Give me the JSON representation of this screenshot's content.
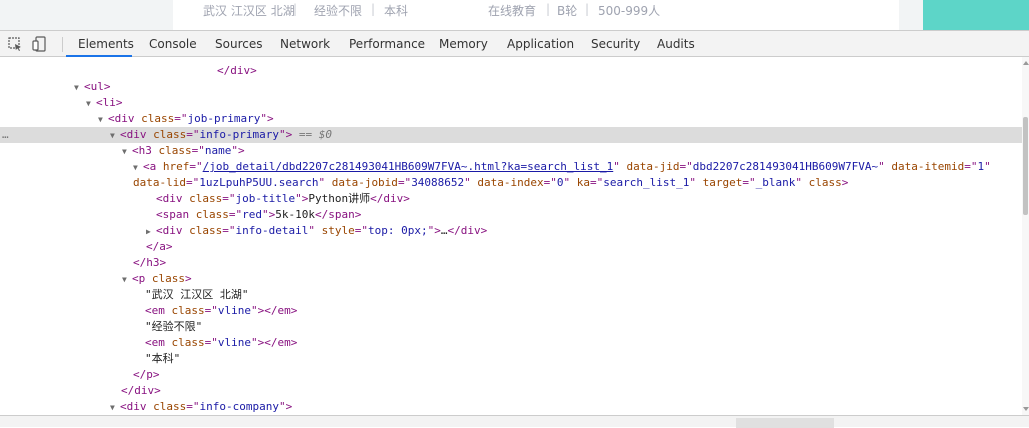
{
  "page": {
    "location": [
      "武汉",
      "江汉区",
      "北湖"
    ],
    "experience": "经验不限",
    "education": "本科",
    "industry": "在线教育",
    "stage": "B轮",
    "size": "500-999人",
    "separator": "|"
  },
  "devtools": {
    "tabs": [
      "Elements",
      "Console",
      "Sources",
      "Network",
      "Performance",
      "Memory",
      "Application",
      "Security",
      "Audits"
    ],
    "active_tab": "Elements",
    "selected_marker": "== $0",
    "dots": "…"
  },
  "tree": {
    "closing_div": "</div>",
    "ul": "<ul>",
    "li": "<li>",
    "div_open": "<div",
    "h3_open": "<h3",
    "a_open": "<a",
    "span_open": "<span",
    "p_open": "<p",
    "em_open": "<em",
    "attr_class": "class",
    "job_primary": "job-primary",
    "info_primary": "info-primary",
    "name": "name",
    "href_attr": "href",
    "href_val": "/job_detail/dbd2207c281493041HB609W7FVA~.html?ka=search_list_1",
    "data_jid_attr": "data-jid",
    "data_jid_val": "dbd2207c281493041HB609W7FVA~",
    "data_itemid_attr": "data-itemid",
    "data_itemid_val": "1",
    "data_lid_attr": "data-lid",
    "data_lid_val": "1uzLpuhP5UU.search",
    "data_jobid_attr": "data-jobid",
    "data_jobid_val": "34088652",
    "data_index_attr": "data-index",
    "data_index_val": "0",
    "ka_attr": "ka",
    "ka_val": "search_list_1",
    "target_attr": "target",
    "target_val": "_blank",
    "job_title_class": "job-title",
    "job_title_text": "Python讲师",
    "red_class": "red",
    "salary_text": "5k-10k",
    "info_detail_class": "info-detail",
    "style_attr": "style",
    "style_val": "top: 0px;",
    "ellipsis": "…",
    "close_a": "</a>",
    "close_h3": "</h3>",
    "close_em": "</em>",
    "close_span": "</span>",
    "close_p": "</p>",
    "vline_class": "vline",
    "text_location": "\"武汉 江汉区 北湖\"",
    "text_experience": "\"经验不限\"",
    "text_education": "\"本科\"",
    "info_company_class": "info-company"
  }
}
